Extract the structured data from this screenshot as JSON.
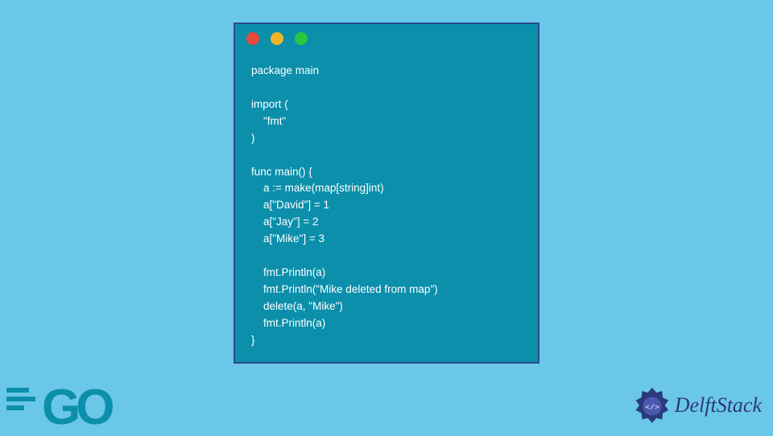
{
  "code": {
    "lines": "package main\n\nimport (\n    \"fmt\"\n)\n\nfunc main() {\n    a := make(map[string]int)\n    a[\"David\"] = 1\n    a[\"Jay\"] = 2\n    a[\"Mike\"] = 3\n\n    fmt.Println(a)\n    fmt.Println(\"Mike deleted from map\")\n    delete(a, \"Mike\")\n    fmt.Println(a)\n}"
  },
  "go_logo": {
    "text": "GO"
  },
  "delft": {
    "text": "DelftStack"
  },
  "traffic": {
    "red": "red",
    "yellow": "yellow",
    "green": "green"
  }
}
